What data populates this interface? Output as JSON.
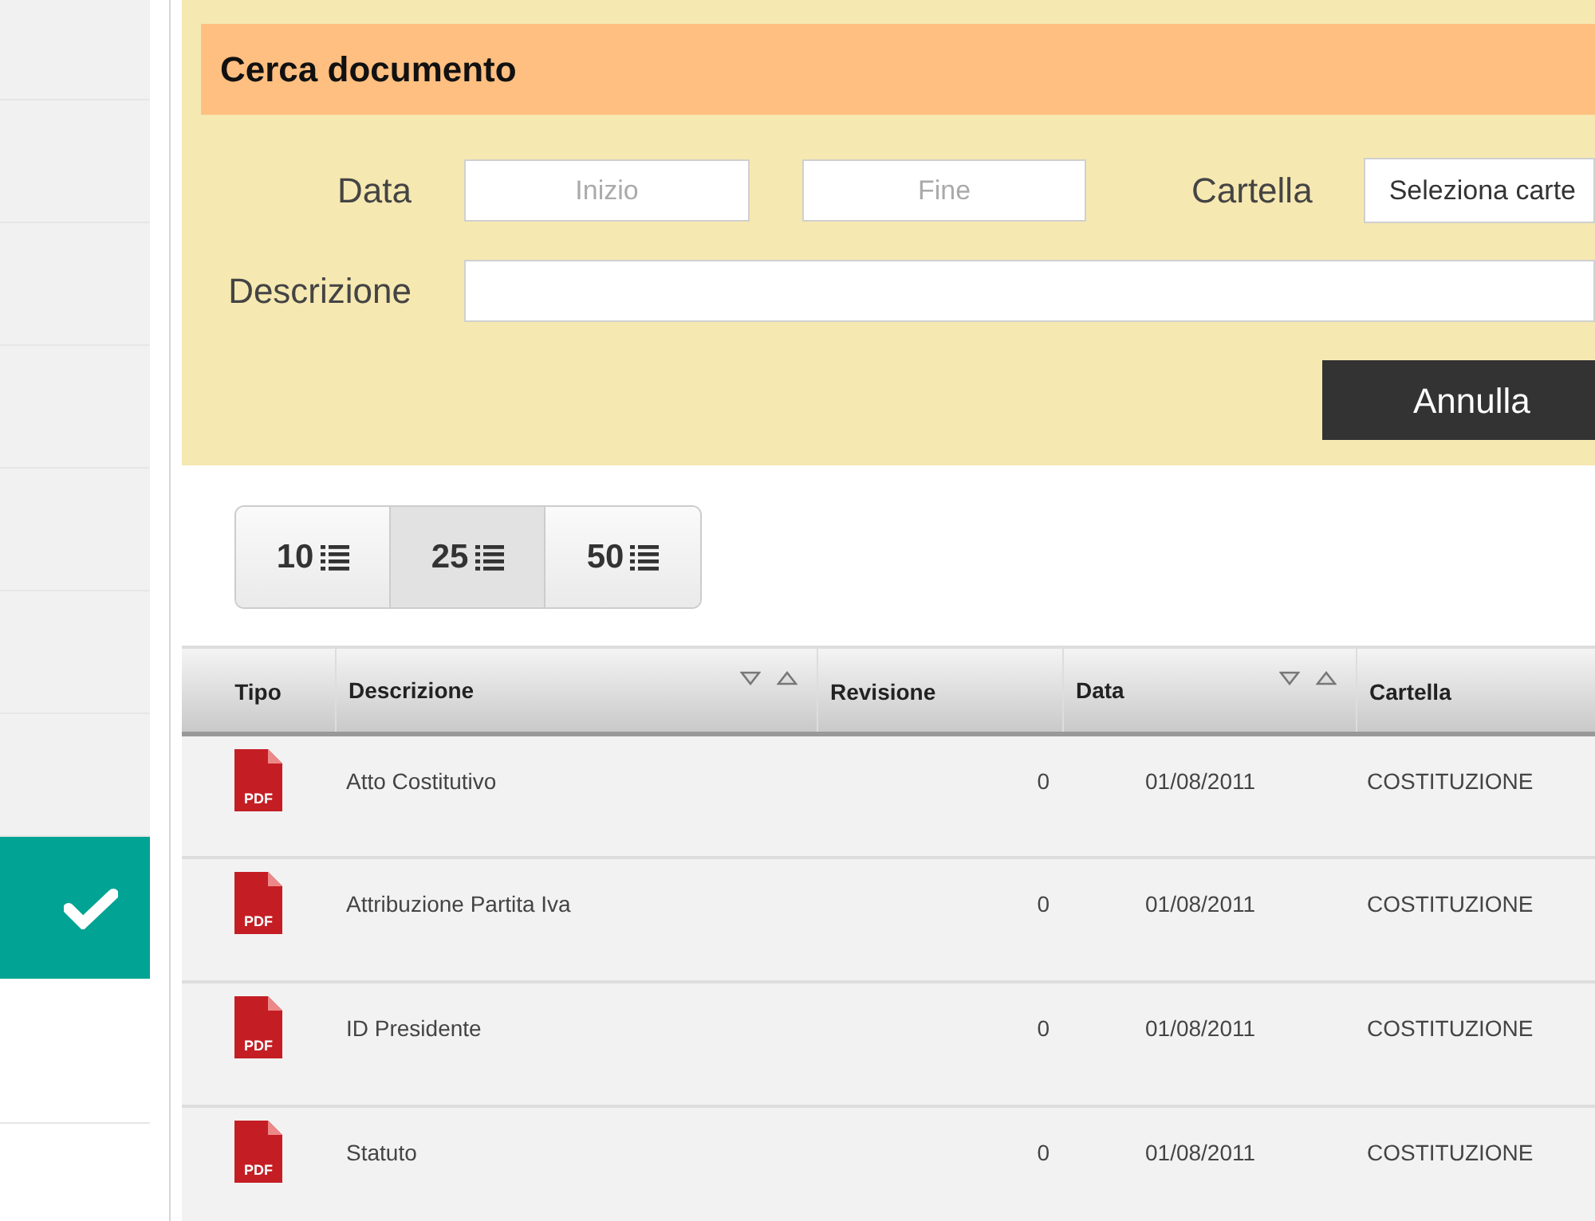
{
  "sidebar": {
    "items": [
      {
        "selected": false
      },
      {
        "selected": false
      },
      {
        "selected": false
      },
      {
        "selected": false
      },
      {
        "selected": false
      },
      {
        "selected": false
      },
      {
        "selected": false
      },
      {
        "selected": true
      },
      {
        "selected": false
      }
    ]
  },
  "search_panel": {
    "title": "Cerca documento",
    "date_label": "Data",
    "start_placeholder": "Inizio",
    "end_placeholder": "Fine",
    "folder_label": "Cartella",
    "folder_value": "Seleziona carte",
    "description_label": "Descrizione",
    "cancel_button": "Annulla"
  },
  "page_sizes": [
    {
      "label": "10",
      "selected": false
    },
    {
      "label": "25",
      "selected": true
    },
    {
      "label": "50",
      "selected": false
    }
  ],
  "table": {
    "columns": [
      {
        "label": "Tipo",
        "sortable": false
      },
      {
        "label": "Descrizione",
        "sortable": true
      },
      {
        "label": "Revisione",
        "sortable": false
      },
      {
        "label": "Data",
        "sortable": true
      },
      {
        "label": "Cartella",
        "sortable": false
      }
    ],
    "rows": [
      {
        "type": "PDF",
        "description": "Atto Costitutivo",
        "revision": "0",
        "date": "01/08/2011",
        "folder": "COSTITUZIONE"
      },
      {
        "type": "PDF",
        "description": "Attribuzione Partita Iva",
        "revision": "0",
        "date": "01/08/2011",
        "folder": "COSTITUZIONE"
      },
      {
        "type": "PDF",
        "description": "ID Presidente",
        "revision": "0",
        "date": "01/08/2011",
        "folder": "COSTITUZIONE"
      },
      {
        "type": "PDF",
        "description": "Statuto",
        "revision": "0",
        "date": "01/08/2011",
        "folder": "COSTITUZIONE"
      }
    ]
  }
}
